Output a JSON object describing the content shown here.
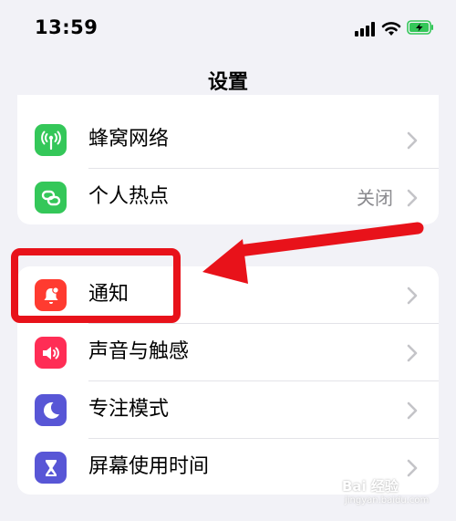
{
  "status_bar": {
    "time": "13:59"
  },
  "nav": {
    "title": "设置"
  },
  "group1": [
    {
      "label": "蜂窝网络",
      "value": "",
      "icon": "cellular-antenna-icon",
      "color": "#34c759"
    },
    {
      "label": "个人热点",
      "value": "关闭",
      "icon": "personal-hotspot-icon",
      "color": "#34c759"
    }
  ],
  "group2": [
    {
      "label": "通知",
      "icon": "notification-bell-icon",
      "color": "#ff3b30"
    },
    {
      "label": "声音与触感",
      "icon": "speaker-icon",
      "color": "#ff2d55"
    },
    {
      "label": "专注模式",
      "icon": "moon-icon",
      "color": "#5856d6"
    },
    {
      "label": "屏幕使用时间",
      "icon": "hourglass-icon",
      "color": "#5856d6"
    }
  ],
  "annotation": {
    "color": "#e8121a"
  },
  "watermark": {
    "text": "Bai 经验",
    "sub": "jingyan.baidu.com"
  }
}
